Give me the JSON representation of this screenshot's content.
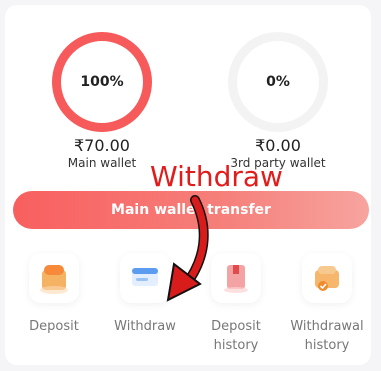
{
  "wallets": {
    "main": {
      "percent": "100%",
      "amount": "₹70.00",
      "label": "Main wallet"
    },
    "third_party": {
      "percent": "0%",
      "amount": "₹0.00",
      "label": "3rd party wallet"
    }
  },
  "transfer_button": {
    "label": "Main wallet transfer"
  },
  "actions": [
    {
      "label": "Deposit",
      "icon": "deposit-icon"
    },
    {
      "label": "Withdraw",
      "icon": "withdraw-card-icon"
    },
    {
      "label": "Deposit history",
      "icon": "deposit-history-icon"
    },
    {
      "label": "Withdrawal history",
      "icon": "withdrawal-history-icon"
    }
  ],
  "annotation": {
    "text": "Withdraw",
    "color": "#e21b1b"
  },
  "colors": {
    "accent": "#f65a5a",
    "ring_empty": "#f3f3f3"
  }
}
